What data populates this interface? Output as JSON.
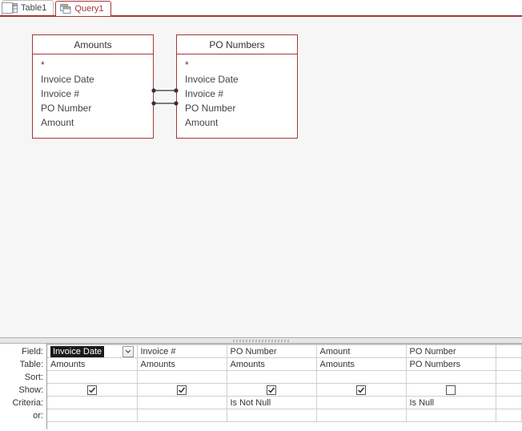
{
  "tabs": [
    {
      "label": "Table1",
      "active": false
    },
    {
      "label": "Query1",
      "active": true
    }
  ],
  "tables": {
    "amounts": {
      "title": "Amounts",
      "fields": [
        "*",
        "Invoice Date",
        "Invoice #",
        "PO Number",
        "Amount"
      ]
    },
    "ponumbers": {
      "title": "PO Numbers",
      "fields": [
        "*",
        "Invoice Date",
        "Invoice #",
        "PO Number",
        "Amount"
      ]
    }
  },
  "qbe": {
    "row_labels": {
      "field": "Field:",
      "table": "Table:",
      "sort": "Sort:",
      "show": "Show:",
      "criteria": "Criteria:",
      "or": "or:"
    },
    "columns": [
      {
        "field": "Invoice Date",
        "table": "Amounts",
        "show": true,
        "criteria": "",
        "selected": true
      },
      {
        "field": "Invoice #",
        "table": "Amounts",
        "show": true,
        "criteria": "",
        "selected": false
      },
      {
        "field": "PO Number",
        "table": "Amounts",
        "show": true,
        "criteria": "Is Not Null",
        "selected": false
      },
      {
        "field": "Amount",
        "table": "Amounts",
        "show": true,
        "criteria": "",
        "selected": false
      },
      {
        "field": "PO Number",
        "table": "PO Numbers",
        "show": false,
        "criteria": "Is Null",
        "selected": false
      }
    ]
  },
  "colors": {
    "accent": "#a4373a"
  }
}
